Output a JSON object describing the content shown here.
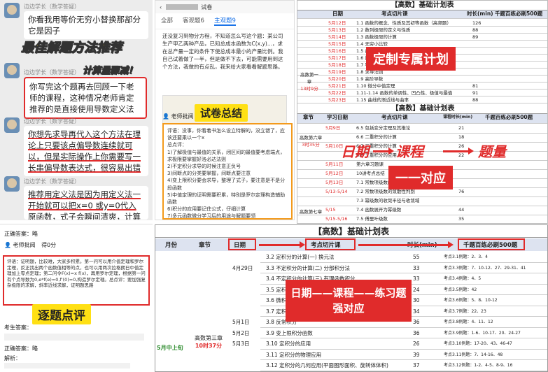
{
  "chat": {
    "sender": "边边学长（数学答疑）",
    "msg1": "你看我用等价无穷小替换那部分它是因子",
    "slogan1": "最佳解题方法推荐",
    "slogan2": "计算量骤减！",
    "msg2": "你写完这个题再去回顾一下老师的课程，这种情况老师肯定推荐的是直接使用导数定义法",
    "msg3": "你想先求导再代入这个方法在理论上只要该点偏导数连续就可以，但是实际操作上你需要写一长串偏导数表达式，很容易出错",
    "msg4": "推荐用定义法是因为用定义法一开始就可以把x=0 或y=0代入原函数，式子会瞬间清爽，计算量骤减"
  },
  "exam": {
    "title": "试卷",
    "tabs": [
      "全部",
      "客观题6",
      "主观题9"
    ],
    "active_tab": "主观题9",
    "question": "还没复习到物分方程，不知道怎么写这个题：某公司生产甲乙两种产品，已知总成本函数为C(x,y)...，求在总产量一定的条件下使总成本最小的产量比例。我自己试着做了一半，但是做不下去，可能需要用到这个方法，我做的有点乱，我来给大家看看解题思路。",
    "teacher": "老师批阅",
    "badge": "试卷总结",
    "review": "评语：没事，你看着书怎么设立特解的，没立错了，应该还要乘以一个x\n总点评：\n1)了解极值与最值的关系，闭区间的最值要考虑端点，求极限要掌握好洛必达法则\n2)不定积分求导的时候注意正负号\n3)间断点的分类要掌握，间断点要注意\n4)变上限积分要会求导，整理了式子，要注意是不是分段函数\n5)中值定理的证明需要积累，特别是罗尔定理构造辅助函数\n6)积分的应用要记住公式，仔细计算\n7)多元函数微分学习后的用途与解题要领"
  },
  "plan_top": {
    "title": "【高数】基础计划表",
    "headers": [
      "日期",
      "考点切片课",
      "时长(min)",
      "千题百练必刷500题"
    ],
    "rows": [
      [
        "5月12日",
        "1.1 函数的概念、性质及其初等函数（高频题）",
        "126",
        ""
      ],
      [
        "5月13日",
        "1.2 数列极限的定义与性质",
        "88",
        ""
      ],
      [
        "5月14日",
        "1.3 函数极限的计算",
        "89",
        ""
      ],
      [
        "5月15日",
        "1.4 无穷小比较",
        "",
        ""
      ],
      [
        "5月16日",
        "1.5 函数的连续性",
        "",
        ""
      ],
      [
        "5月17日",
        "1.6 间断点的判断",
        "",
        ""
      ],
      [
        "5月18日",
        "1.7 导数定义的应用",
        "",
        ""
      ],
      [
        "5月19日",
        "1.8 求导法则",
        "",
        ""
      ],
      [
        "5月20日",
        "1.9 高阶导数",
        "",
        ""
      ],
      [
        "5月21日",
        "1.10 微分中值定理",
        "81",
        ""
      ],
      [
        "5月22日",
        "1.11-1.14 函数的单调性、凹凸性、极值与最值",
        "91",
        ""
      ],
      [
        "5月23日",
        "1.15 曲线的渐近线与曲率",
        "88",
        ""
      ]
    ],
    "chapter": "高数第一章",
    "chapter_time": "13时9分",
    "badge": "定制专属计划"
  },
  "plan_mid": {
    "title": "【高数】基础计划表",
    "headers": [
      "章节",
      "学习日期",
      "考点切片课",
      "课程时长(min)",
      "千题百练必刷500题"
    ],
    "chapter": "高数第六章",
    "chapter_time": "3时35分",
    "rows": [
      [
        "5月9日",
        "6.5 包括变分定理及其推论",
        "21",
        ""
      ],
      [
        "",
        "6.6 二重积分的计算",
        "18",
        ""
      ],
      [
        "5月10日",
        "6.7 三重积分的计算",
        "26",
        ""
      ],
      [
        "",
        "6.8 三重积分的应用",
        "22",
        ""
      ],
      [
        "5月11日",
        "第六章习题课",
        "",
        ""
      ],
      [
        "5月12日",
        "10讲考点总结",
        "",
        ""
      ],
      [
        "5月13日",
        "7.1 常数项级数的概念与性质",
        "",
        ""
      ],
      [
        "5/13-5/14",
        "7.2 常数项级数的敛散性判别",
        "76",
        ""
      ],
      [
        "",
        "7.3 幂级数的收敛半径与收敛域",
        "",
        ""
      ],
      [
        "5/15",
        "7.4 函数展开为幂级数",
        "44",
        ""
      ],
      [
        "5/15-5/16",
        "7.5 傅里叶级数",
        "35",
        ""
      ]
    ],
    "chapter2": "高数第七章",
    "flow": [
      "日期",
      "课程",
      "题量"
    ],
    "badge": "一一对应"
  },
  "eval": {
    "answer": "正确答案：略",
    "teacher": "老师批阅",
    "score": "得0分",
    "text": "评语：证明题，比较难，大家多积累。第一问可以用介值定理和罗尔定理，反正找出两个函数值相等的点，也可以用两次拉格朗日中值定理加上零点定理；第二问令F(x)=x f(x)，再用罗尔定理，根据第一问有个点导数为0,e*f(e)=0,f'(0)=0,构造罗尔定理。总点评：要加强复杂极限的求解，斜率近线求解，证明题思路",
    "badge": "逐题点评",
    "answer2": "考生答案：",
    "answer3": "正确答案：略",
    "analysis": "解析："
  },
  "plan_bottom": {
    "title": "【高数】基础计划表",
    "headers": [
      "月份",
      "章节",
      "日期",
      "考点切片课",
      "时长(min)",
      "千题百练必刷500题"
    ],
    "month": "5月中上旬",
    "chapter": "高数第三章",
    "chapter_time": "10时37分",
    "rows": [
      [
        "",
        "3.2 定积分的计算(一) 换元法",
        "55",
        "考点3.1例题：2、3、4"
      ],
      [
        "4月29日",
        "3.3 不定积分的计算(二) 分部积分法",
        "33",
        "考点3.3例题：7、10-12、27、29-31、41"
      ],
      [
        "",
        "3.4 不定积分的计算(三) 有理函数积分",
        "33",
        "考点3.4例题：4、5"
      ],
      [
        "",
        "3.5 定积分的概念与性质",
        "24",
        "考点3.5例题：42"
      ],
      [
        "",
        "3.6 微积分基本定理",
        "30",
        "考点3.6例题：5、8、10-12"
      ],
      [
        "",
        "3.7 定积分的计算",
        "34",
        "考点3.7例题：22、23"
      ],
      [
        "5月1日",
        "3.8 反常积分",
        "36",
        "考点3.8例题：4、11、12"
      ],
      [
        "5月2日",
        "3.9 变上限积分函数",
        "36",
        "考点3.9例题：1-6、10-17、20、24-27"
      ],
      [
        "5月3日",
        "3.10 定积分的应用",
        "26",
        "考点3.10例题：17-20、43、46-47"
      ],
      [
        "",
        "3.11 定积分的物理应用",
        "39",
        "考点3.11例题：7、14-16、48"
      ],
      [
        "",
        "3.12 定积分的几何应用(平面图形面积、旋转体体积)",
        "37",
        "考点3.12例题：1-2、4-5、8-9、16"
      ]
    ],
    "badge_line1": "日期——课程——练习题",
    "badge_line2": "强对应"
  }
}
